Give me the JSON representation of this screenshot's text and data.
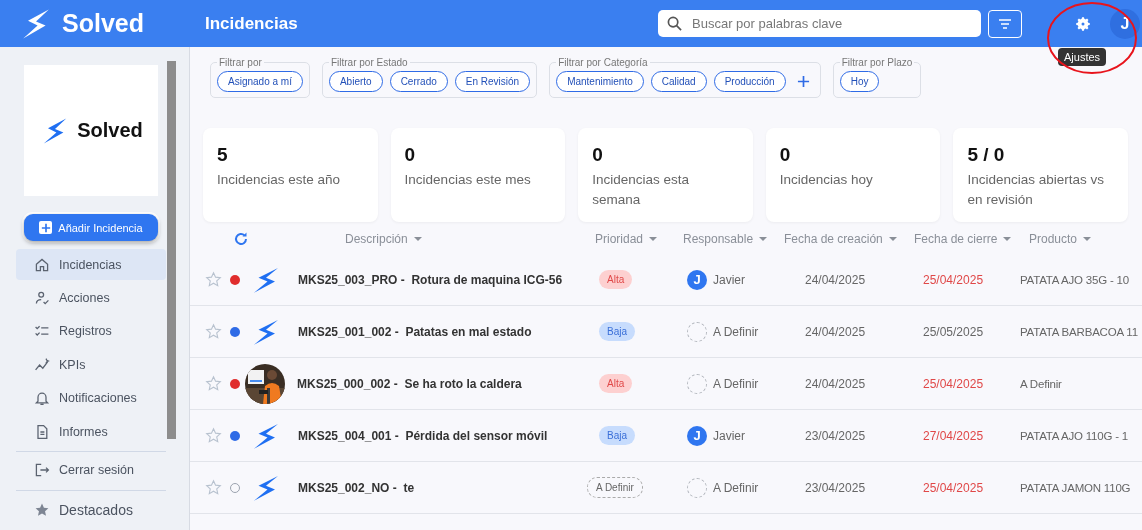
{
  "header": {
    "brand": "Solved",
    "title": "Incidencias",
    "search": {
      "placeholder": "Buscar por palabras clave"
    },
    "tooltip": "Ajustes",
    "avatar_initial": "J"
  },
  "sidebar": {
    "brand": "Solved",
    "add_button": "Añadir Incidencia",
    "items": [
      {
        "label": "Incidencias",
        "selected": true
      },
      {
        "label": "Acciones",
        "selected": false
      },
      {
        "label": "Registros",
        "selected": false
      },
      {
        "label": "KPIs",
        "selected": false
      },
      {
        "label": "Notificaciones",
        "selected": false
      },
      {
        "label": "Informes",
        "selected": false
      }
    ],
    "logout": "Cerrar sesión",
    "favorites": "Destacados"
  },
  "filters": [
    {
      "legend": "Filtrar por",
      "chips": [
        "Asignado a mí"
      ],
      "addable": false
    },
    {
      "legend": "Filtrar por Estado",
      "chips": [
        "Abierto",
        "Cerrado",
        "En Revisión"
      ],
      "addable": false
    },
    {
      "legend": "Filtrar por Categoría",
      "chips": [
        "Mantenimiento",
        "Calidad",
        "Producción"
      ],
      "addable": true
    },
    {
      "legend": "Filtrar por Plazo",
      "chips": [
        "Hoy"
      ],
      "addable": false
    }
  ],
  "stats": [
    {
      "value": "5",
      "label": "Incidencias este año"
    },
    {
      "value": "0",
      "label": "Incidencias este mes"
    },
    {
      "value": "0",
      "label": "Incidencias esta semana"
    },
    {
      "value": "0",
      "label": "Incidencias hoy"
    },
    {
      "value": "5 / 0",
      "label": "Incidencias abiertas vs en revisión"
    }
  ],
  "table": {
    "columns": [
      "Descripción",
      "Prioridad",
      "Responsable",
      "Fecha de creación",
      "Fecha de cierre",
      "Producto"
    ],
    "rows": [
      {
        "starred": false,
        "dot": {
          "filled": true,
          "color": "#e02d2d"
        },
        "thumb": {
          "kind": "logo"
        },
        "code": "MKS25_003_PRO -",
        "title": "Rotura de maquina ICG-56",
        "priority": {
          "kind": "alta",
          "label": "Alta"
        },
        "assignee": {
          "assigned": true,
          "initial": "J",
          "name": "Javier"
        },
        "created": "24/04/2025",
        "closing": {
          "date": "25/04/2025",
          "overdue": true
        },
        "product": "PATATA AJO 35G - 10"
      },
      {
        "starred": false,
        "dot": {
          "filled": true,
          "color": "#2f6be6"
        },
        "thumb": {
          "kind": "logo"
        },
        "code": "MKS25_001_002 -",
        "title": "Patatas en mal estado",
        "priority": {
          "kind": "baja",
          "label": "Baja"
        },
        "assignee": {
          "assigned": false,
          "name": "A Definir"
        },
        "created": "24/04/2025",
        "closing": {
          "date": "25/05/2025",
          "overdue": false
        },
        "product": "PATATA BARBACOA 11"
      },
      {
        "starred": false,
        "dot": {
          "filled": true,
          "color": "#e02d2d"
        },
        "code": "MKS25_000_002 -",
        "title": "Se ha roto la caldera",
        "priority": {
          "kind": "alta",
          "label": "Alta"
        },
        "assignee": {
          "assigned": false,
          "name": "A Definir"
        },
        "created": "24/04/2025",
        "closing": {
          "date": "25/04/2025",
          "overdue": true
        },
        "product": "A Definir"
      },
      {
        "starred": false,
        "dot": {
          "filled": true,
          "color": "#2f6be6"
        },
        "thumb": {
          "kind": "logo"
        },
        "code": "MKS25_004_001 -",
        "title": "Pérdida del sensor móvil",
        "priority": {
          "kind": "baja",
          "label": "Baja"
        },
        "assignee": {
          "assigned": true,
          "initial": "J",
          "name": "Javier"
        },
        "created": "23/04/2025",
        "closing": {
          "date": "27/04/2025",
          "overdue": true
        },
        "product": "PATATA AJO 110G - 1"
      },
      {
        "starred": false,
        "dot": {
          "filled": false,
          "color": "#9ca3af"
        },
        "thumb": {
          "kind": "logo"
        },
        "code": "MKS25_002_NO -",
        "title": "te",
        "priority": {
          "kind": "undefined",
          "label": "A Definir"
        },
        "assignee": {
          "assigned": false,
          "name": "A Definir"
        },
        "created": "23/04/2025",
        "closing": {
          "date": "25/04/2025",
          "overdue": true
        },
        "product": "PATATA JAMON 110G"
      }
    ]
  }
}
